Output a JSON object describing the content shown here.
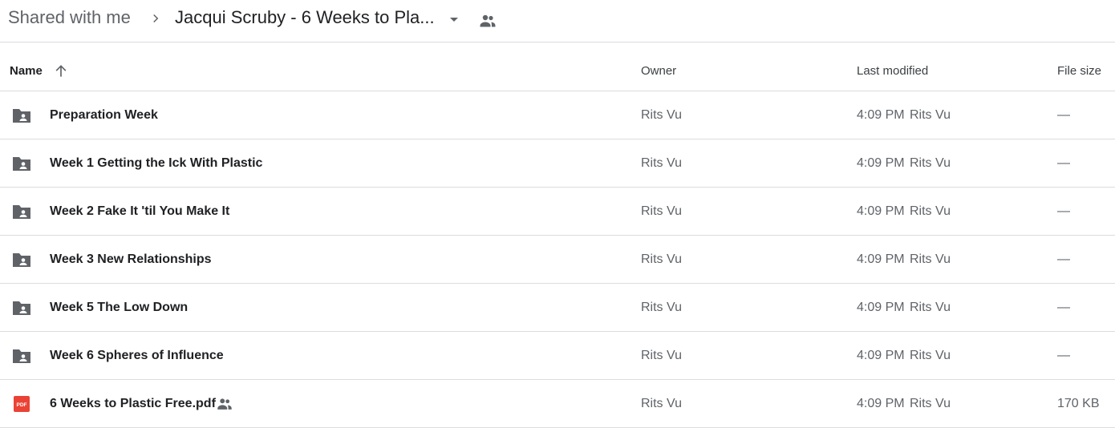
{
  "breadcrumb": {
    "root": "Shared with me",
    "current": "Jacqui Scruby - 6 Weeks to Pla...",
    "separator_icon": "chevron-right-icon",
    "dropdown_icon": "caret-down-icon",
    "shared_icon": "people-icon"
  },
  "columns": {
    "name": "Name",
    "owner": "Owner",
    "last_modified": "Last modified",
    "file_size": "File size",
    "sort_icon": "arrow-up-icon"
  },
  "files": [
    {
      "name": "Preparation Week",
      "type": "shared-folder",
      "owner": "Rits Vu",
      "modified_time": "4:09 PM",
      "modified_by": "Rits Vu",
      "size": "—"
    },
    {
      "name": "Week 1 Getting the Ick With Plastic",
      "type": "shared-folder",
      "owner": "Rits Vu",
      "modified_time": "4:09 PM",
      "modified_by": "Rits Vu",
      "size": "—"
    },
    {
      "name": "Week 2 Fake It 'til You Make It",
      "type": "shared-folder",
      "owner": "Rits Vu",
      "modified_time": "4:09 PM",
      "modified_by": "Rits Vu",
      "size": "—"
    },
    {
      "name": "Week 3 New Relationships",
      "type": "shared-folder",
      "owner": "Rits Vu",
      "modified_time": "4:09 PM",
      "modified_by": "Rits Vu",
      "size": "—"
    },
    {
      "name": "Week 5 The Low Down",
      "type": "shared-folder",
      "owner": "Rits Vu",
      "modified_time": "4:09 PM",
      "modified_by": "Rits Vu",
      "size": "—"
    },
    {
      "name": "Week 6 Spheres of Influence",
      "type": "shared-folder",
      "owner": "Rits Vu",
      "modified_time": "4:09 PM",
      "modified_by": "Rits Vu",
      "size": "—"
    },
    {
      "name": "6 Weeks to Plastic Free.pdf",
      "type": "pdf",
      "icon_label": "PDF",
      "shared": true,
      "owner": "Rits Vu",
      "modified_time": "4:09 PM",
      "modified_by": "Rits Vu",
      "size": "170 KB"
    }
  ],
  "colors": {
    "folder_icon": "#5f6368",
    "pdf_icon": "#ea4335",
    "divider": "#dadce0"
  }
}
